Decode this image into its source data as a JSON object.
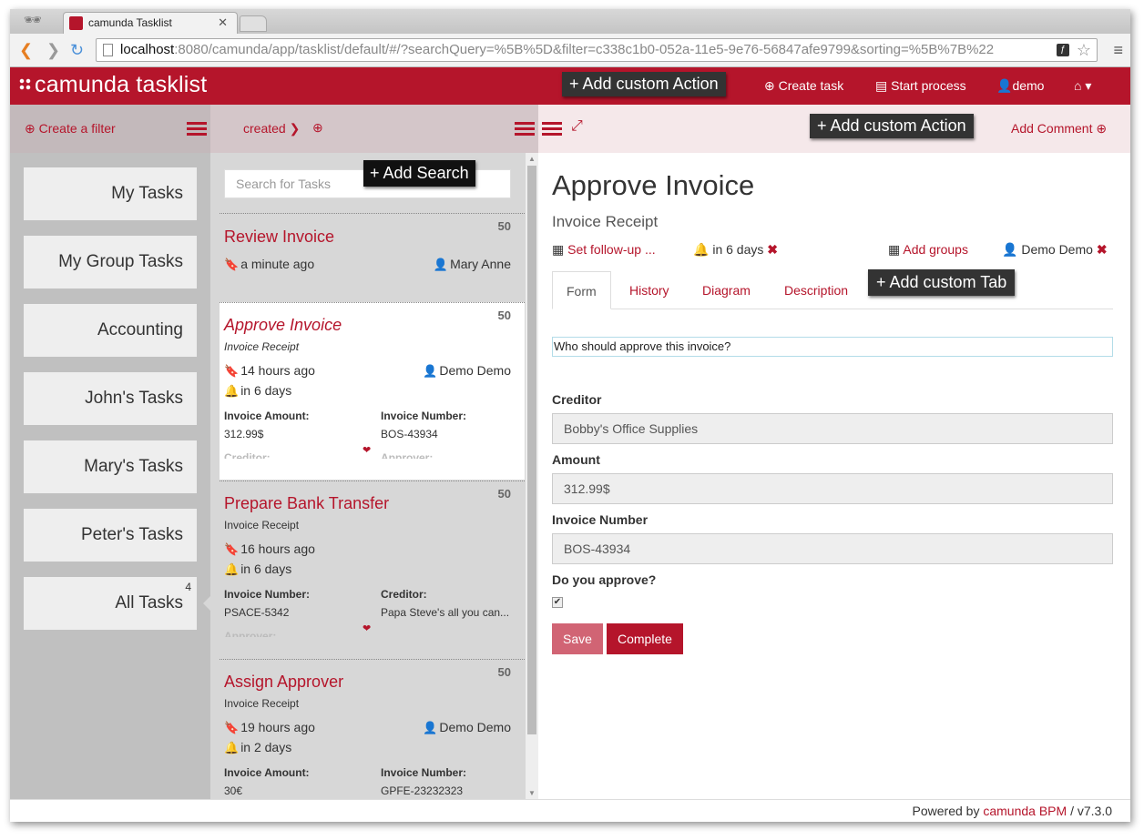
{
  "browser": {
    "tab_title": "camunda Tasklist",
    "url_host": "localhost",
    "url_rest": ":8080/camunda/app/tasklist/default/#/?searchQuery=%5B%5D&filter=c338c1b0-052a-11e5-9e76-56847afe9799&sorting=%5B%7B%22"
  },
  "header": {
    "brand": "camunda tasklist",
    "custom_action": "+ Add custom Action",
    "create_task": "Create task",
    "start_process": "Start process",
    "user": "demo"
  },
  "filters_header": {
    "create_filter": "Create a filter"
  },
  "filters": [
    {
      "label": "My Tasks"
    },
    {
      "label": "My Group Tasks"
    },
    {
      "label": "Accounting"
    },
    {
      "label": "John's Tasks"
    },
    {
      "label": "Mary's Tasks"
    },
    {
      "label": "Peter's Tasks"
    },
    {
      "label": "All Tasks",
      "count": "4"
    }
  ],
  "list_header": {
    "sort_label": "created"
  },
  "search": {
    "placeholder": "Search for Tasks",
    "add_search": "+ Add Search"
  },
  "tasks": [
    {
      "name": "Review Invoice",
      "priority": "50",
      "created": "a minute ago",
      "assignee": "Mary Anne"
    },
    {
      "name": "Approve Invoice",
      "process": "Invoice Receipt",
      "priority": "50",
      "created": "14 hours ago",
      "due": "in 6 days",
      "assignee": "Demo Demo",
      "vars": [
        {
          "label": "Invoice Amount:",
          "value": "312.99$"
        },
        {
          "label": "Invoice Number:",
          "value": "BOS-43934"
        },
        {
          "label": "Creditor:"
        },
        {
          "label": "Approver:"
        }
      ]
    },
    {
      "name": "Prepare Bank Transfer",
      "process": "Invoice Receipt",
      "priority": "50",
      "created": "16 hours ago",
      "due": "in 6 days",
      "vars": [
        {
          "label": "Invoice Number:",
          "value": "PSACE-5342"
        },
        {
          "label": "Creditor:",
          "value": "Papa Steve's all you can..."
        },
        {
          "label": "Approver:"
        }
      ]
    },
    {
      "name": "Assign Approver",
      "process": "Invoice Receipt",
      "priority": "50",
      "created": "19 hours ago",
      "due": "in 2 days",
      "assignee": "Demo Demo",
      "vars": [
        {
          "label": "Invoice Amount:",
          "value": "30€"
        },
        {
          "label": "Invoice Number:",
          "value": "GPFE-23232323"
        }
      ]
    }
  ],
  "detail_header": {
    "custom_action": "+ Add custom Action",
    "add_comment": "Add Comment"
  },
  "detail": {
    "title": "Approve Invoice",
    "process": "Invoice Receipt",
    "follow_up": "Set follow-up ...",
    "due": "in 6 days",
    "add_groups": "Add groups",
    "assignee": "Demo Demo",
    "tabs": [
      "Form",
      "History",
      "Diagram",
      "Description"
    ],
    "add_tab": "+ Add custom Tab",
    "form": {
      "question": "Who should approve this invoice?",
      "creditor_label": "Creditor",
      "creditor_value": "Bobby's Office Supplies",
      "amount_label": "Amount",
      "amount_value": "312.99$",
      "invoice_label": "Invoice Number",
      "invoice_value": "BOS-43934",
      "approve_label": "Do you approve?",
      "approve_checked": true,
      "save": "Save",
      "complete": "Complete"
    }
  },
  "footer": {
    "prefix": "Powered by ",
    "brand": "camunda BPM",
    "version": " / v7.3.0"
  },
  "colors": {
    "brand": "#b5152b",
    "save_button": "#d16474"
  }
}
